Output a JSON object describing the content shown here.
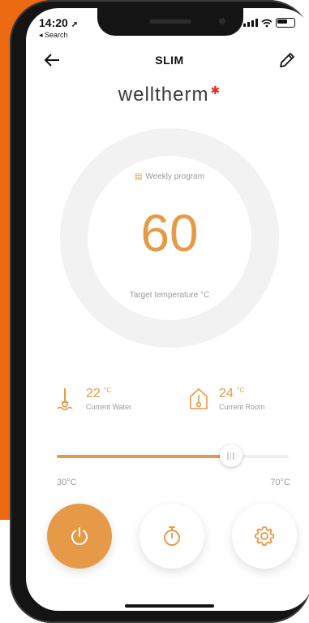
{
  "status_bar": {
    "time": "14:20",
    "back_label": "◂ Search"
  },
  "header": {
    "title": "SLIM"
  },
  "logo": {
    "text": "welltherm"
  },
  "dial": {
    "program_label": "Weekly program",
    "target_value": "60",
    "target_label": "Target temperature °C"
  },
  "readings": {
    "water": {
      "value": "22",
      "unit": "°C",
      "label": "Current Water"
    },
    "room": {
      "value": "24",
      "unit": "°C",
      "label": "Current Room"
    }
  },
  "slider": {
    "min_label": "30°C",
    "max_label": "70°C",
    "min": 30,
    "max": 70,
    "value": 60
  },
  "colors": {
    "accent": "#e69a47",
    "brand_orange": "#ec6a12",
    "logo_dot": "#e52b1e",
    "muted_text": "#9a9a9a"
  },
  "icons": {
    "back": "arrow-left-icon",
    "edit": "pencil-icon",
    "program": "calendar-icon",
    "water": "water-temperature-icon",
    "room": "room-temperature-icon",
    "power": "power-icon",
    "timer": "stopwatch-icon",
    "settings": "gear-icon"
  }
}
